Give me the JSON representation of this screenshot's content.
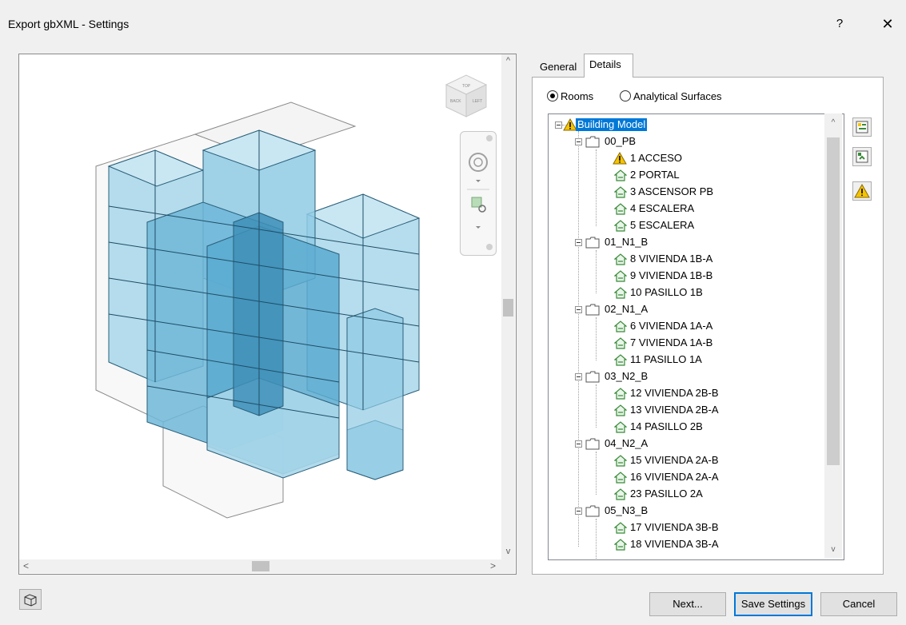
{
  "window": {
    "title": "Export gbXML - Settings",
    "help_label": "?",
    "close_label": "✕"
  },
  "viewer": {
    "viewcube_faces": [
      "TOP",
      "LEFT",
      "BACK"
    ],
    "scroll": {
      "up": "^",
      "down": "v",
      "left": "<",
      "right": ">"
    }
  },
  "tabs": {
    "general": "General",
    "details": "Details",
    "active": "Details"
  },
  "mode": {
    "rooms": "Rooms",
    "analytical": "Analytical Surfaces",
    "selected": "Rooms"
  },
  "tree": {
    "root": "Building Model",
    "levels": [
      {
        "name": "00_PB",
        "rooms": [
          {
            "label": "1 ACCESO",
            "warning": true
          },
          {
            "label": "2 PORTAL"
          },
          {
            "label": "3 ASCENSOR PB"
          },
          {
            "label": "4 ESCALERA"
          },
          {
            "label": "5 ESCALERA"
          }
        ]
      },
      {
        "name": "01_N1_B",
        "rooms": [
          {
            "label": "8 VIVIENDA 1B-A"
          },
          {
            "label": "9 VIVIENDA 1B-B"
          },
          {
            "label": "10 PASILLO 1B"
          }
        ]
      },
      {
        "name": "02_N1_A",
        "rooms": [
          {
            "label": "6 VIVIENDA 1A-A"
          },
          {
            "label": "7 VIVIENDA 1A-B"
          },
          {
            "label": "11 PASILLO 1A"
          }
        ]
      },
      {
        "name": "03_N2_B",
        "rooms": [
          {
            "label": "12 VIVIENDA 2B-B"
          },
          {
            "label": "13 VIVIENDA 2B-A"
          },
          {
            "label": "14 PASILLO 2B"
          }
        ]
      },
      {
        "name": "04_N2_A",
        "rooms": [
          {
            "label": "15 VIVIENDA 2A-B"
          },
          {
            "label": "16 VIVIENDA 2A-A"
          },
          {
            "label": "23 PASILLO 2A"
          }
        ]
      },
      {
        "name": "05_N3_B",
        "rooms": [
          {
            "label": "17 VIVIENDA 3B-B"
          },
          {
            "label": "18 VIVIENDA 3B-A"
          }
        ]
      }
    ]
  },
  "buttons": {
    "next": "Next...",
    "save": "Save Settings",
    "cancel": "Cancel"
  },
  "colors": {
    "accent": "#0078d7",
    "room_icon": "#3a8a3a",
    "warning": "#f5c400",
    "model_fill": "#7fc4e0"
  }
}
